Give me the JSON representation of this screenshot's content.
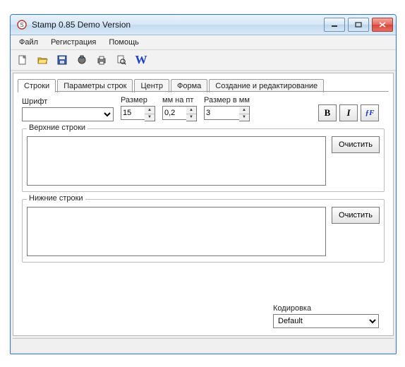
{
  "window": {
    "title": "Stamp 0.85 Demo Version",
    "controls": {
      "minimize": "—",
      "maximize": "☐",
      "close": "✕"
    }
  },
  "menu": {
    "file": "Файл",
    "registration": "Регистрация",
    "help": "Помощь"
  },
  "toolbar_icons": {
    "new": "new",
    "open": "open",
    "save": "save",
    "design": "design",
    "print": "print",
    "preview": "preview",
    "word": "W"
  },
  "tabs": {
    "lines": "Строки",
    "line_params": "Параметры строк",
    "center": "Центр",
    "shape": "Форма",
    "create_edit": "Создание и редактирование"
  },
  "fields": {
    "font_label": "Шрифт",
    "font_value": "",
    "size_label": "Размер",
    "size_value": "15",
    "mmpt_label": "мм на пт",
    "mmpt_value": "0,2",
    "sizemm_label": "Размер в мм",
    "sizemm_value": "3"
  },
  "fmt": {
    "bold": "B",
    "italic": "I",
    "func": "ƒF"
  },
  "groups": {
    "top_label": "Верхние строки",
    "top_value": "",
    "bottom_label": "Нижние строки",
    "bottom_value": "",
    "clear": "Очистить"
  },
  "encoding": {
    "label": "Кодировка",
    "value": "Default"
  }
}
